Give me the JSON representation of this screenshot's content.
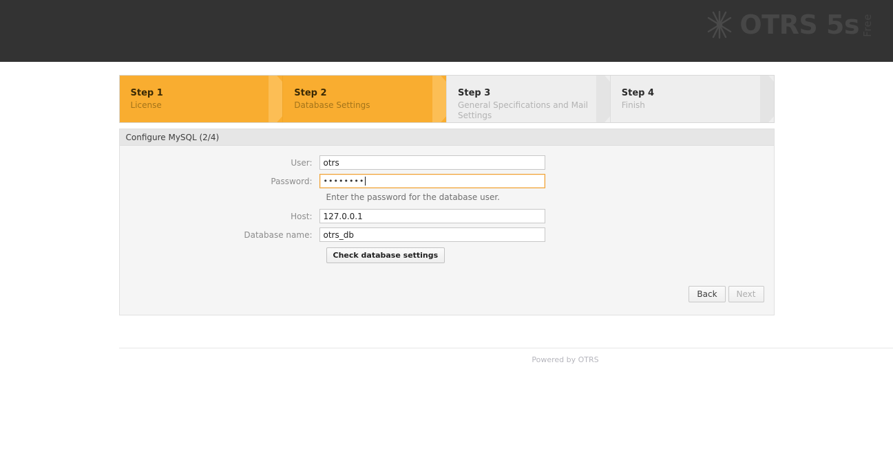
{
  "header": {
    "product_name": "OTRS 5s",
    "edition_label": "Free",
    "logo_icon": "otrs-star-icon",
    "background_color": "#333333"
  },
  "steps": [
    {
      "title": "Step 1",
      "subtitle": "License",
      "state": "active"
    },
    {
      "title": "Step 2",
      "subtitle": "Database Settings",
      "state": "active"
    },
    {
      "title": "Step 3",
      "subtitle": "General Specifications and Mail Settings",
      "state": "inactive"
    },
    {
      "title": "Step 4",
      "subtitle": "Finish",
      "state": "inactive"
    }
  ],
  "panel": {
    "title": "Configure MySQL (2/4)",
    "fields": {
      "user": {
        "label": "User:",
        "value": "otrs",
        "placeholder": ""
      },
      "password": {
        "label": "Password:",
        "value": "••••••••",
        "placeholder": "",
        "hint": "Enter the password for the database user.",
        "focused": true
      },
      "host": {
        "label": "Host:",
        "value": "127.0.0.1",
        "placeholder": ""
      },
      "database_name": {
        "label": "Database name:",
        "value": "otrs_db",
        "placeholder": ""
      }
    },
    "check_button_label": "Check database settings",
    "back_button_label": "Back",
    "next_button_label": "Next",
    "next_button_state": "disabled"
  },
  "footer": {
    "text": "Powered by OTRS"
  },
  "colors": {
    "accent_orange": "#f9ad30",
    "chevron_orange": "#fcbe55",
    "focus_border": "#f0a030",
    "header_dark": "#333333",
    "panel_bg": "#f5f5f5"
  }
}
